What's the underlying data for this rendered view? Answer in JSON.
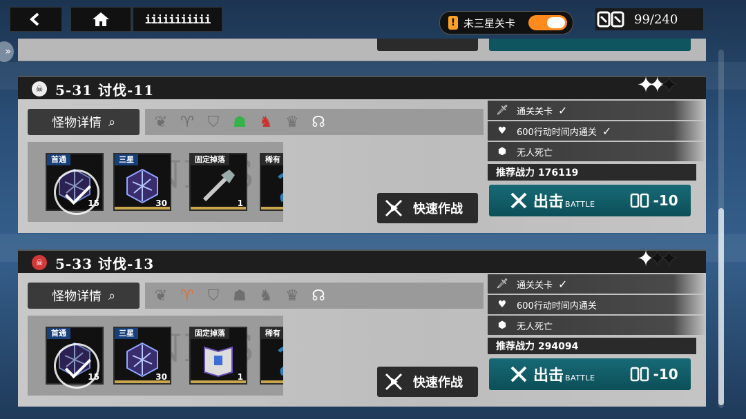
{
  "topbar": {
    "back_label": "<",
    "home_label": "⌂",
    "menu_label": "iiiiiiiiiii",
    "filter_label": "未三星关卡",
    "filter_warn": "!",
    "filter_on": true,
    "stamina": "99/240"
  },
  "stages": [
    {
      "title": "5-31 讨伐-11",
      "icon": "skull-icon",
      "stars_lit": 2,
      "monster_btn": "怪物详情",
      "traits": [
        "laurel-icon",
        "ram-icon",
        "shield-icon",
        "beast-icon",
        "wolf-icon",
        "crown-icon",
        "halo-icon"
      ],
      "trait_states": [
        "off",
        "off",
        "off",
        "on-green",
        "on-red",
        "off",
        "white"
      ],
      "rewards": [
        {
          "tag": "首通",
          "count": "15",
          "claimed": true
        },
        {
          "tag": "三星",
          "count": "30",
          "claimed": false
        },
        {
          "tag": "固定掉落",
          "count": "1",
          "claimed": false
        },
        {
          "tag": "稀有",
          "count": "",
          "claimed": false
        }
      ],
      "goals": [
        {
          "text": "通关关卡",
          "done": true,
          "icon": "sword-icon"
        },
        {
          "text": "600行动时间内通关",
          "done": true,
          "icon": "heart-icon"
        },
        {
          "text": "无人死亡",
          "done": false,
          "icon": "hex-icon"
        }
      ],
      "power": "推荐战力 176119",
      "quick_label": "快速作战",
      "battle_label": "出击",
      "battle_sub": "BATTLE",
      "cost": "-10",
      "watermark": "NIRS"
    },
    {
      "title": "5-33 讨伐-13",
      "icon": "demon-skull-icon",
      "stars_lit": 1,
      "monster_btn": "怪物详情",
      "traits": [
        "laurel-icon",
        "ram-icon",
        "shield-icon",
        "beast-icon",
        "wolf-icon",
        "crown-icon",
        "halo-icon"
      ],
      "trait_states": [
        "off",
        "on-orange",
        "off",
        "off",
        "off",
        "off",
        "white"
      ],
      "rewards": [
        {
          "tag": "首通",
          "count": "15",
          "claimed": true
        },
        {
          "tag": "三星",
          "count": "30",
          "claimed": false
        },
        {
          "tag": "固定掉落",
          "count": "1",
          "claimed": false
        },
        {
          "tag": "稀有",
          "count": "",
          "claimed": false
        }
      ],
      "goals": [
        {
          "text": "通关关卡",
          "done": true,
          "icon": "sword-icon"
        },
        {
          "text": "600行动时间内通关",
          "done": false,
          "icon": "heart-icon"
        },
        {
          "text": "无人死亡",
          "done": false,
          "icon": "hex-icon"
        }
      ],
      "power": "推荐战力 294094",
      "quick_label": "快速作战",
      "battle_label": "出击",
      "battle_sub": "BATTLE",
      "cost": "-10",
      "watermark": "NIRS"
    }
  ],
  "colors": {
    "battle_teal": "#0f5a64",
    "toggle_orange": "#ff8a1e",
    "tag_blue": "#173f7a",
    "trait_green": "#35b24a",
    "trait_red": "#c8322e",
    "trait_orange": "#d8743f"
  }
}
